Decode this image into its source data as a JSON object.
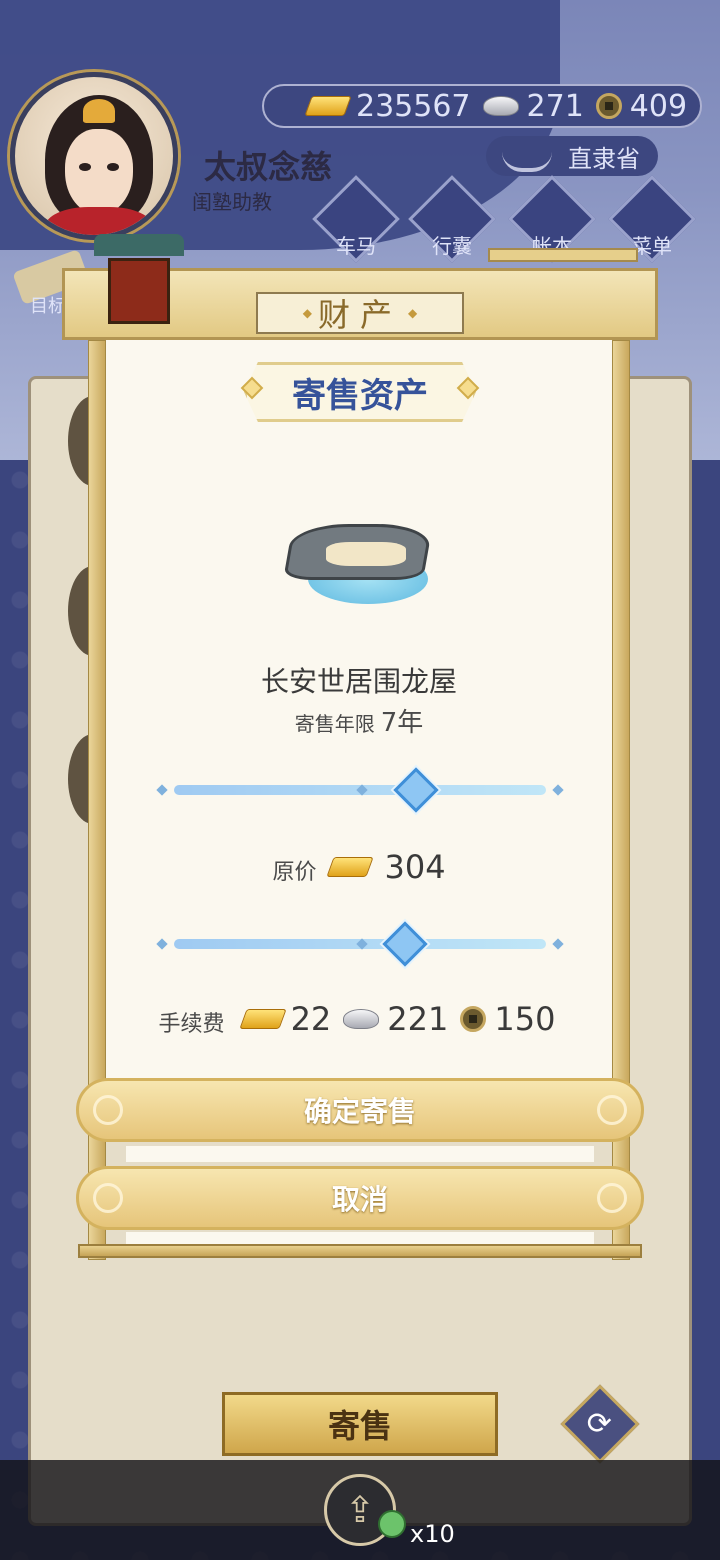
{
  "player": {
    "name": "太叔念慈",
    "title": "闺塾助教"
  },
  "currency": {
    "gold": "235567",
    "silver": "271",
    "coin": "409"
  },
  "location": "直隶省",
  "nav": {
    "items": [
      {
        "label": "车马",
        "icon": "carriage-icon"
      },
      {
        "label": "行囊",
        "icon": "bag-icon"
      },
      {
        "label": "帐本",
        "icon": "ledger-icon"
      },
      {
        "label": "菜单",
        "icon": "menu-icon"
      }
    ]
  },
  "goal_label": "目标",
  "modal": {
    "header": "财产",
    "section_title": "寄售资产",
    "asset_name": "长安世居围龙屋",
    "term_label": "寄售年限",
    "term_value": "7年",
    "term_slider_fraction": 0.65,
    "price_label": "原价",
    "price_value": "304",
    "price_slider_fraction": 0.62,
    "fee_label": "手续费",
    "fee_gold": "22",
    "fee_silver": "221",
    "fee_coin": "150",
    "confirm_label": "确定寄售",
    "cancel_label": "取消"
  },
  "bottom": {
    "sell_label": "寄售",
    "refresh_icon": "refresh-icon",
    "share_icon": "share-icon",
    "share_count": "x10"
  }
}
